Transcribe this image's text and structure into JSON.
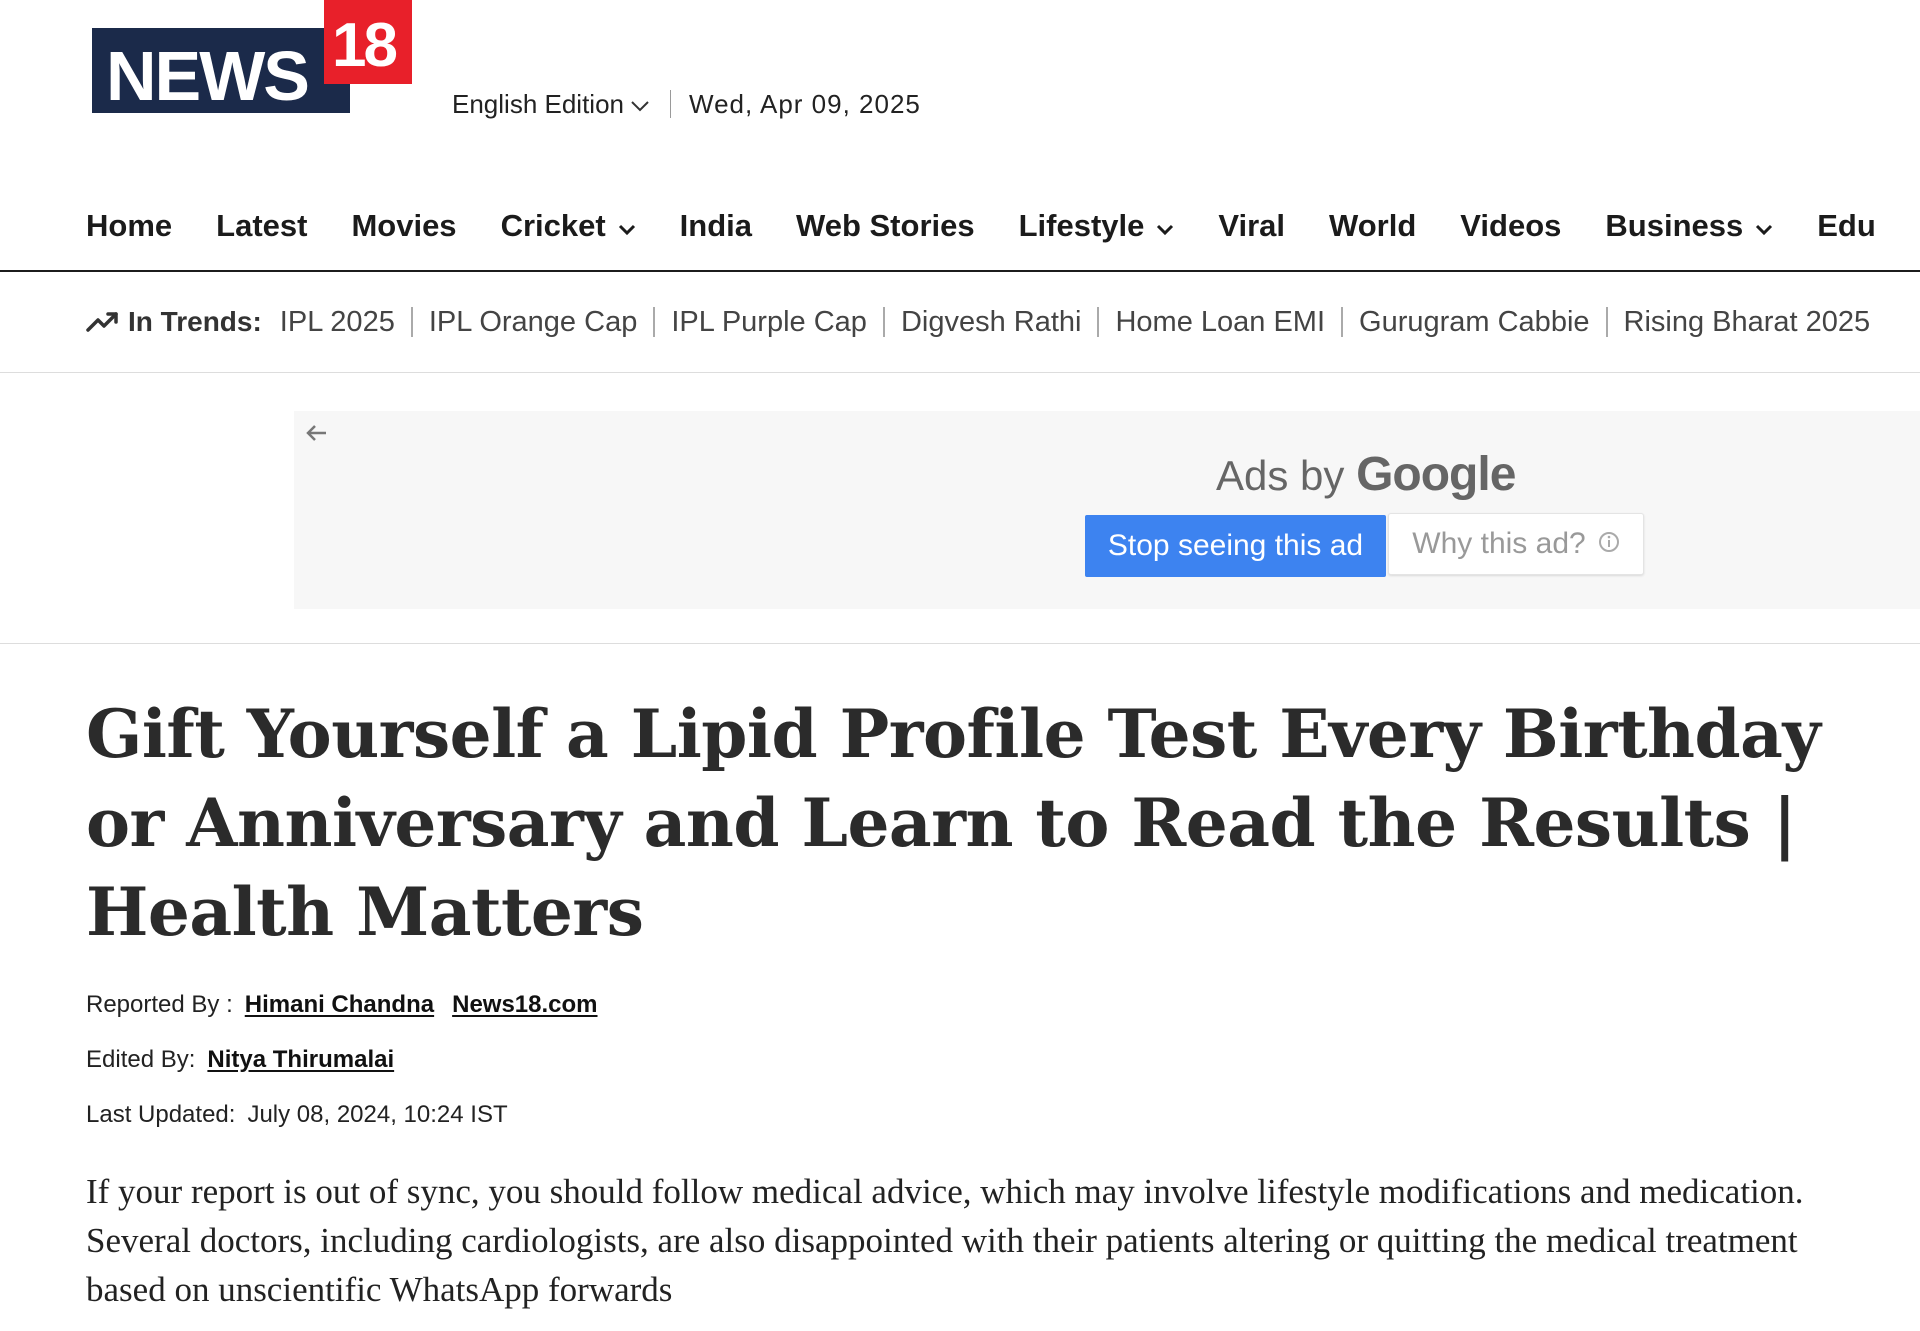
{
  "header": {
    "logo_text": "NEWS",
    "logo_number": "18",
    "edition_label": "English Edition",
    "date": "Wed, Apr 09, 2025"
  },
  "nav": {
    "items": [
      {
        "label": "Home",
        "dropdown": false
      },
      {
        "label": "Latest",
        "dropdown": false
      },
      {
        "label": "Movies",
        "dropdown": false
      },
      {
        "label": "Cricket",
        "dropdown": true
      },
      {
        "label": "India",
        "dropdown": false
      },
      {
        "label": "Web Stories",
        "dropdown": false
      },
      {
        "label": "Lifestyle",
        "dropdown": true
      },
      {
        "label": "Viral",
        "dropdown": false
      },
      {
        "label": "World",
        "dropdown": false
      },
      {
        "label": "Videos",
        "dropdown": false
      },
      {
        "label": "Business",
        "dropdown": true
      },
      {
        "label": "Edu",
        "dropdown": false
      }
    ]
  },
  "trends": {
    "label": "In Trends:",
    "items": [
      "IPL 2025",
      "IPL Orange Cap",
      "IPL Purple Cap",
      "Digvesh Rathi",
      "Home Loan EMI",
      "Gurugram Cabbie",
      "Rising Bharat 2025"
    ]
  },
  "ad": {
    "ads_by": "Ads by",
    "google": "Google",
    "stop_label": "Stop seeing this ad",
    "why_label": "Why this ad?",
    "stop_color": "#3d83f0"
  },
  "article": {
    "headline": "Gift Yourself a Lipid Profile Test Every Birthday or Anniversary and Learn to Read the Results | Health Matters",
    "reported_label": "Reported By :",
    "reporter": "Himani Chandna",
    "source": "News18.com",
    "edited_label": "Edited By:",
    "editor": "Nitya Thirumalai",
    "updated_label": "Last Updated:",
    "updated_value": "July 08, 2024, 10:24 IST",
    "summary": "If your report is out of sync, you should follow medical advice, which may involve lifestyle modifications and medication. Several doctors, including cardiologists, are also disappointed with their patients altering or quitting the medical treatment based on unscientific WhatsApp forwards"
  },
  "colors": {
    "logo_navy": "#1b2a4a",
    "logo_red": "#e8202a",
    "nav_text": "#1b1b1b"
  }
}
